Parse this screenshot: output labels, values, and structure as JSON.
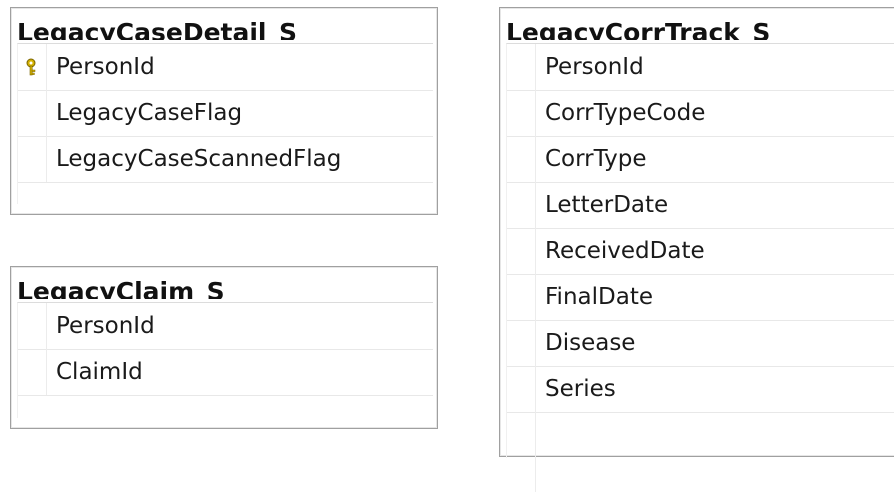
{
  "colors": {
    "border": "#a0a0a0",
    "grid_line": "#e8e8e8",
    "key_icon": "#d4b100",
    "text": "#1a1a1a"
  },
  "tables": {
    "legacy_case_detail": {
      "title": "LegacyCaseDetail_S",
      "columns": [
        {
          "name": "PersonId",
          "primary_key": true,
          "icon": "key-icon"
        },
        {
          "name": "LegacyCaseFlag",
          "primary_key": false
        },
        {
          "name": "LegacyCaseScannedFlag",
          "primary_key": false
        }
      ]
    },
    "legacy_claim": {
      "title": "LegacyClaim_S",
      "columns": [
        {
          "name": "PersonId",
          "primary_key": false
        },
        {
          "name": "ClaimId",
          "primary_key": false
        }
      ]
    },
    "legacy_corr_track": {
      "title": "LegacyCorrTrack_S",
      "columns": [
        {
          "name": "PersonId",
          "primary_key": false
        },
        {
          "name": "CorrTypeCode",
          "primary_key": false
        },
        {
          "name": "CorrType",
          "primary_key": false
        },
        {
          "name": "LetterDate",
          "primary_key": false
        },
        {
          "name": "ReceivedDate",
          "primary_key": false
        },
        {
          "name": "FinalDate",
          "primary_key": false
        },
        {
          "name": "Disease",
          "primary_key": false
        },
        {
          "name": "Series",
          "primary_key": false
        }
      ]
    }
  }
}
